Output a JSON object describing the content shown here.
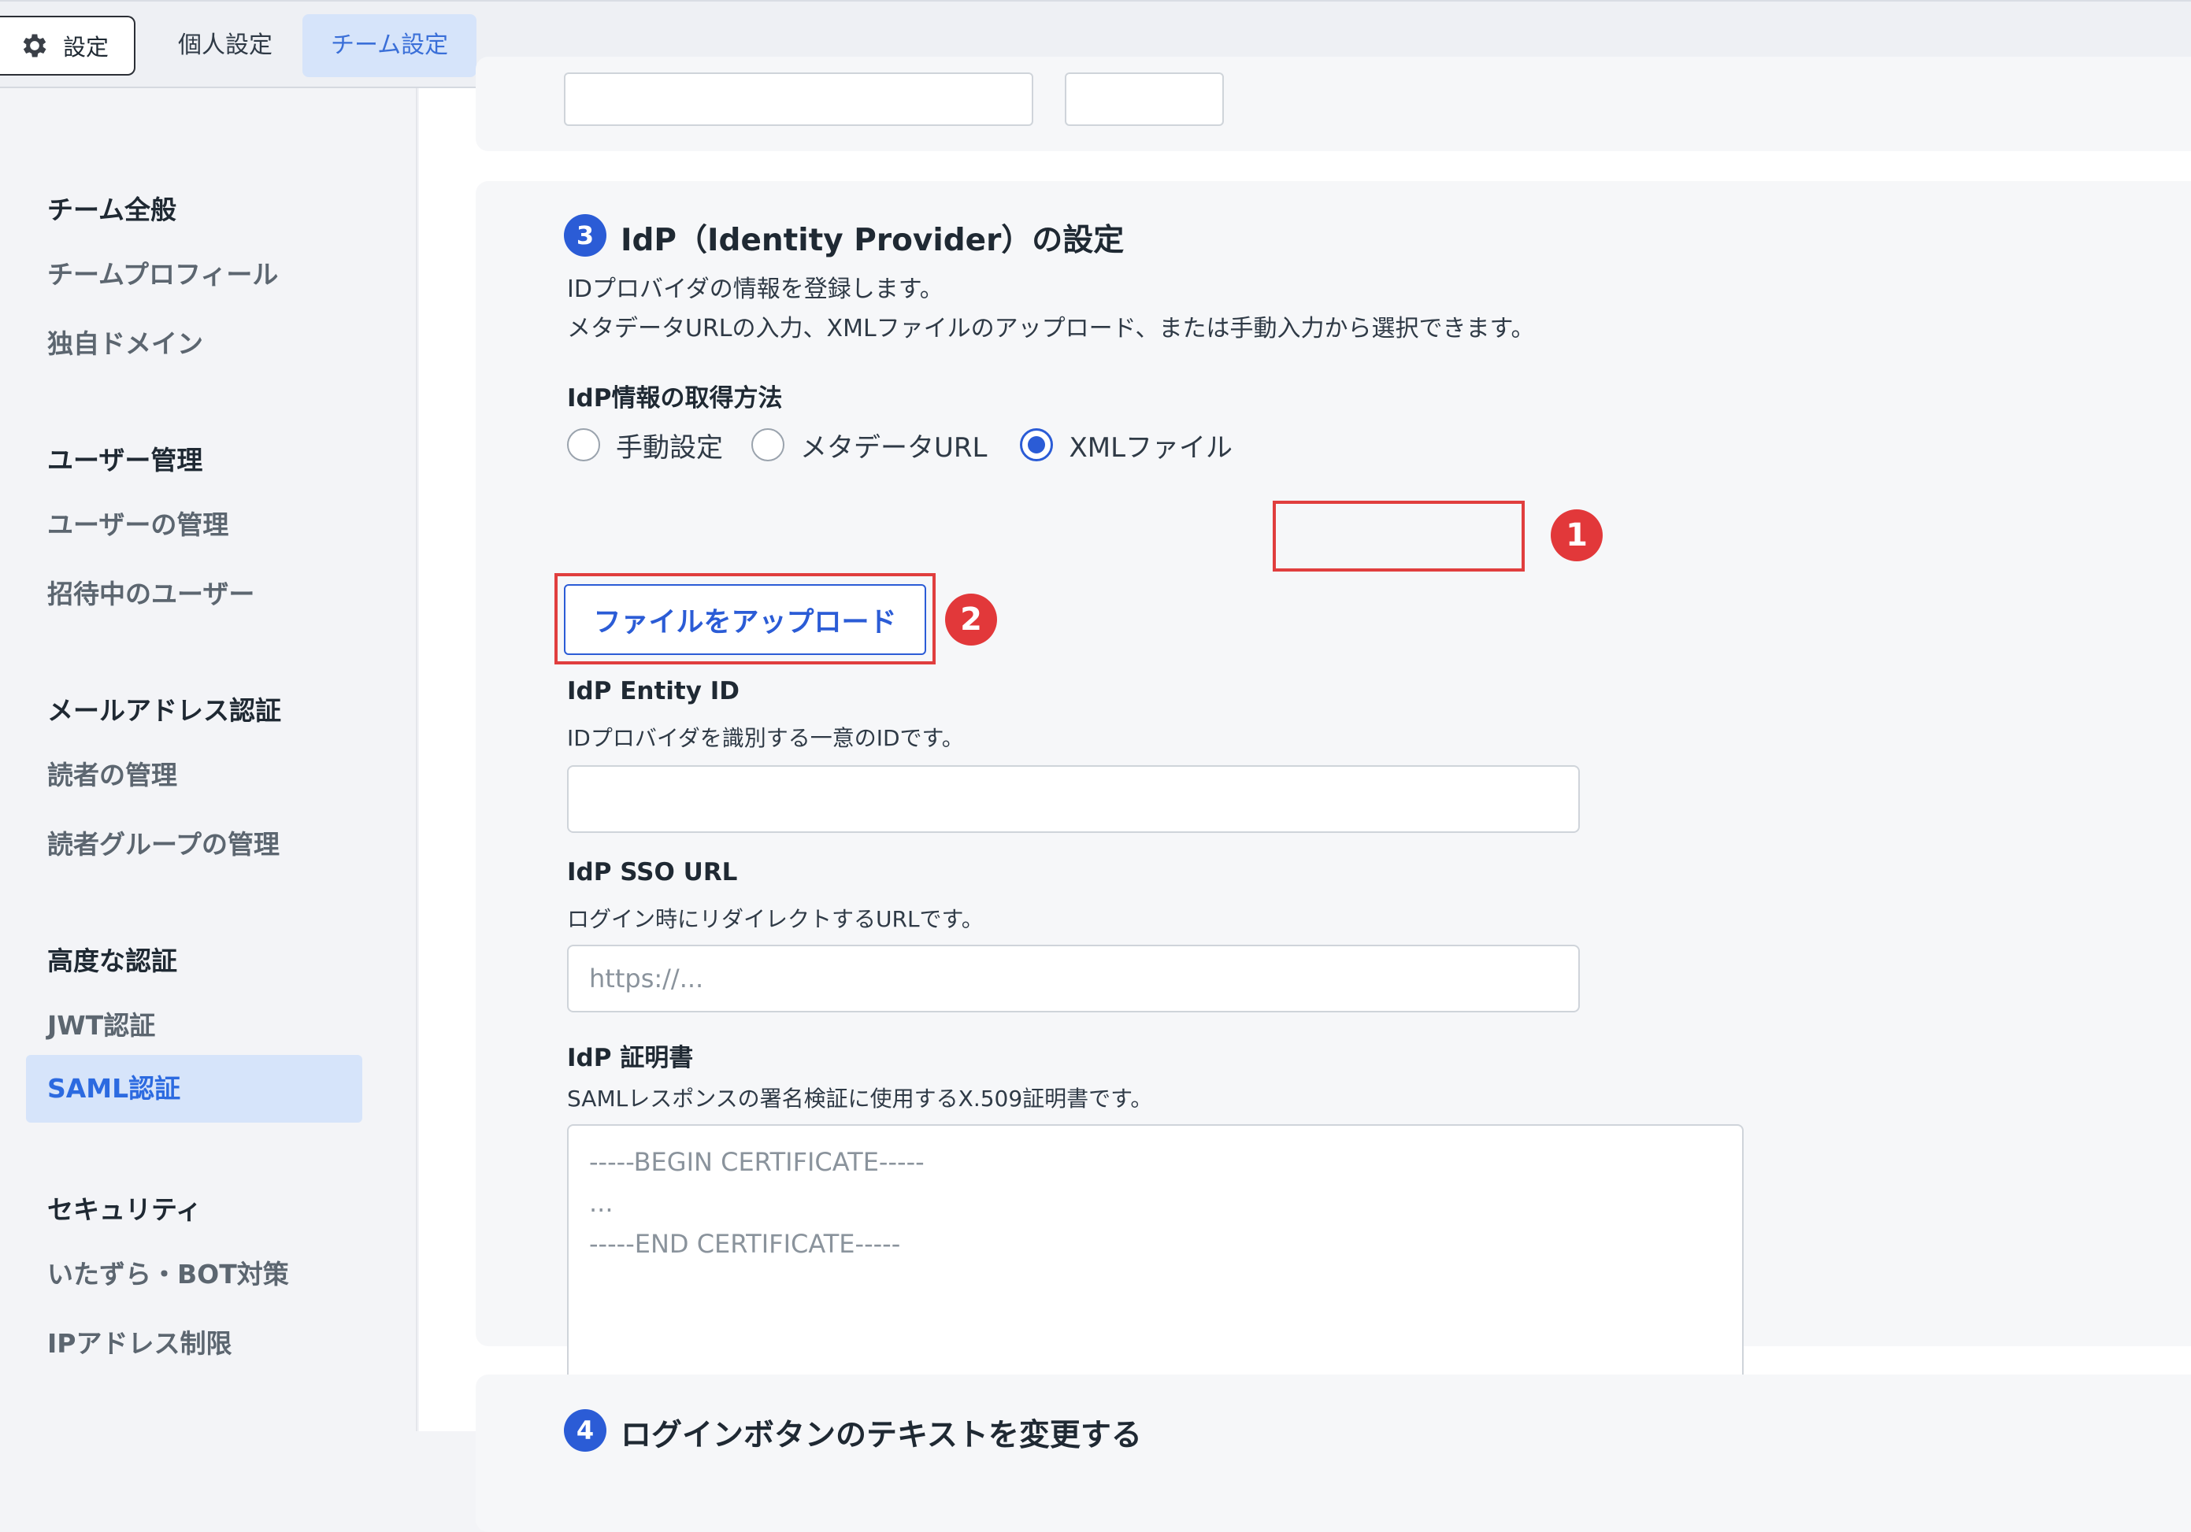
{
  "topbar": {
    "settings_label": "設定",
    "tabs": [
      {
        "label": "個人設定",
        "active": false
      },
      {
        "label": "チーム設定",
        "active": true
      }
    ]
  },
  "sidebar": {
    "groups": [
      {
        "heading": "チーム全般",
        "items": [
          "チームプロフィール",
          "独自ドメイン"
        ]
      },
      {
        "heading": "ユーザー管理",
        "items": [
          "ユーザーの管理",
          "招待中のユーザー"
        ]
      },
      {
        "heading": "メールアドレス認証",
        "items": [
          "読者の管理",
          "読者グループの管理"
        ]
      },
      {
        "heading": "高度な認証",
        "items": [
          "JWT認証",
          "SAML認証"
        ]
      },
      {
        "heading": "セキュリティ",
        "items": [
          "いたずら・BOT対策",
          "IPアドレス制限"
        ]
      }
    ],
    "active_item": "SAML認証"
  },
  "section3": {
    "step": "3",
    "title": "IdP（Identity Provider）の設定",
    "desc_line1": "IDプロバイダの情報を登録します。",
    "desc_line2": "メタデータURLの入力、XMLファイルのアップロード、または手動入力から選択できます。",
    "method_label": "IdP情報の取得方法",
    "methods": [
      {
        "label": "手動設定",
        "checked": false
      },
      {
        "label": "メタデータURL",
        "checked": false
      },
      {
        "label": "XMLファイル",
        "checked": true
      }
    ],
    "marker1": "1",
    "marker2": "2",
    "upload_label": "ファイルをアップロード",
    "entity_id": {
      "label": "IdP Entity ID",
      "help": "IDプロバイダを識別する一意のIDです。",
      "value": "",
      "placeholder": ""
    },
    "sso_url": {
      "label": "IdP SSO URL",
      "help": "ログイン時にリダイレクトするURLです。",
      "placeholder": "https://..."
    },
    "certificate": {
      "label": "IdP 証明書",
      "help": "SAMLレスポンスの署名検証に使用するX.509証明書です。",
      "placeholder": "-----BEGIN CERTIFICATE-----\n...\n-----END CERTIFICATE-----"
    }
  },
  "section4": {
    "step": "4",
    "title": "ログインボタンのテキストを変更する"
  },
  "colors": {
    "accent": "#2b5cd6",
    "highlight": "#e03e3e",
    "active_bg": "#d6e4fa"
  }
}
